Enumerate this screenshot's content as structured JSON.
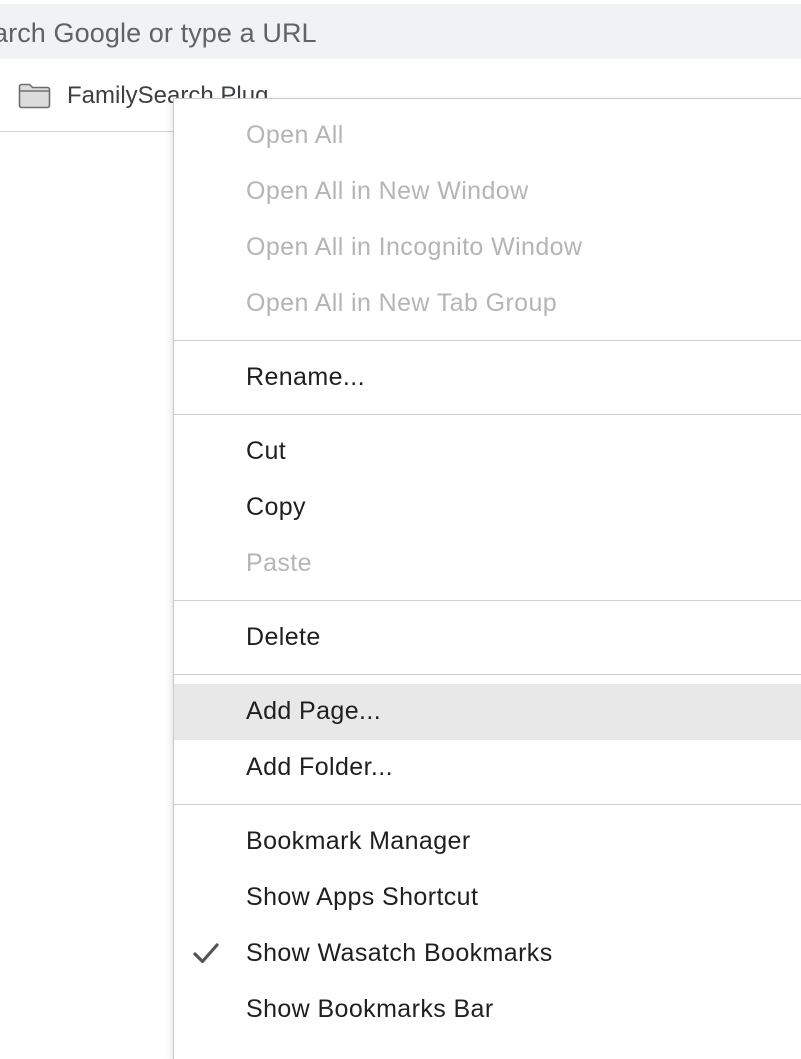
{
  "omnibox": {
    "placeholder": "arch Google or type a URL"
  },
  "bookmarks_bar": {
    "folder": {
      "icon": "folder-icon",
      "label": "FamilySearch Plug"
    }
  },
  "context_menu": {
    "items": [
      {
        "label": "Open All",
        "enabled": false
      },
      {
        "label": "Open All in New Window",
        "enabled": false
      },
      {
        "label": "Open All in Incognito Window",
        "enabled": false
      },
      {
        "label": "Open All in New Tab Group",
        "enabled": false
      },
      {
        "label": "Rename...",
        "enabled": true
      },
      {
        "label": "Cut",
        "enabled": true
      },
      {
        "label": "Copy",
        "enabled": true
      },
      {
        "label": "Paste",
        "enabled": false
      },
      {
        "label": "Delete",
        "enabled": true
      },
      {
        "label": "Add Page...",
        "enabled": true,
        "highlighted": true
      },
      {
        "label": "Add Folder...",
        "enabled": true
      },
      {
        "label": "Bookmark Manager",
        "enabled": true
      },
      {
        "label": "Show Apps Shortcut",
        "enabled": true
      },
      {
        "label": "Show Wasatch Bookmarks",
        "enabled": true,
        "checked": true
      },
      {
        "label": "Show Bookmarks Bar",
        "enabled": true
      }
    ],
    "check_icon": "checkmark-icon"
  },
  "colors": {
    "omnibox_bg": "#f1f2f4",
    "disabled_text": "#b5b5b5",
    "highlight_bg": "#e8e8e8"
  }
}
